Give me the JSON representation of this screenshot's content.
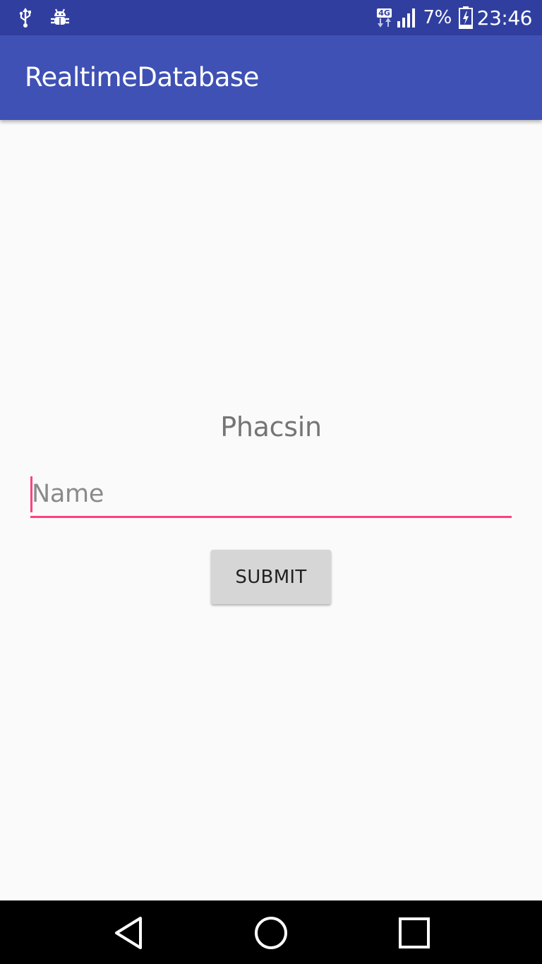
{
  "status_bar": {
    "icons_left": [
      "usb-icon",
      "debug-bug-icon"
    ],
    "network_type": "4G",
    "battery_percent": "7%",
    "clock": "23:46",
    "icons_right": [
      "data-arrows-icon",
      "signal-bars-icon",
      "battery-charging-icon"
    ]
  },
  "app_bar": {
    "title": "RealtimeDatabase"
  },
  "main": {
    "label": "Phacsin",
    "name_input": {
      "value": "",
      "placeholder": "Name"
    },
    "submit_label": "SUBMIT"
  },
  "nav_bar": {
    "icons": [
      "back-icon",
      "home-icon",
      "recents-icon"
    ]
  },
  "colors": {
    "status_bar": "#303f9f",
    "app_bar": "#3f51b5",
    "accent": "#ff4081",
    "background": "#fafafa",
    "button": "#d6d6d6"
  }
}
